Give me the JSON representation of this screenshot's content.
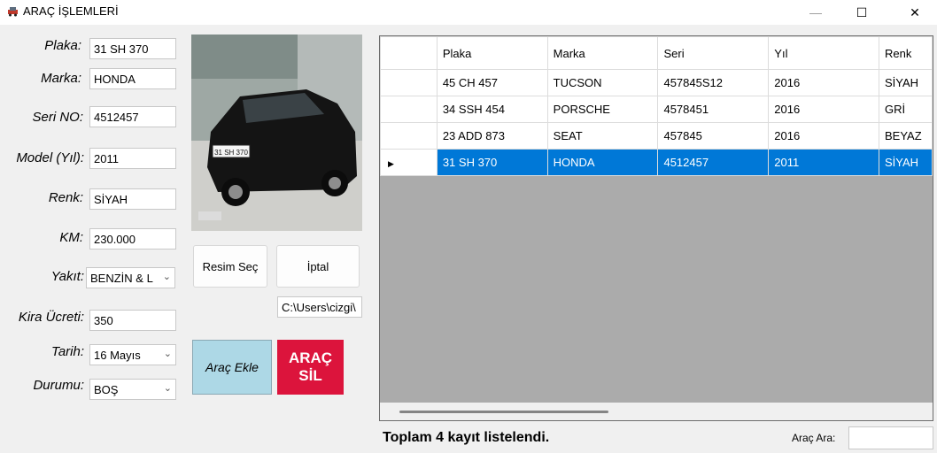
{
  "window": {
    "title": "ARAÇ İŞLEMLERİ",
    "minimize_glyph": "—",
    "maximize_glyph": "☐",
    "close_glyph": "✕"
  },
  "form": {
    "plaka_label": "Plaka:",
    "plaka_value": "31 SH 370",
    "marka_label": "Marka:",
    "marka_value": "HONDA",
    "seri_label": "Seri NO:",
    "seri_value": "4512457",
    "model_label": "Model (Yıl):",
    "model_value": "2011",
    "renk_label": "Renk:",
    "renk_value": "SİYAH",
    "km_label": "KM:",
    "km_value": "230.000",
    "yakit_label": "Yakıt:",
    "yakit_value": "BENZİN & L",
    "kira_label": "Kira Ücreti:",
    "kira_value": "350",
    "tarih_label": "Tarih:",
    "tarih_value": "16  Mayıs",
    "durum_label": "Durumu:",
    "durum_value": "BOŞ"
  },
  "image_panel": {
    "plate_text": "31 SH 370",
    "select_button": "Resim Seç",
    "cancel_button": "İptal",
    "path_value": "C:\\Users\\cizgi\\"
  },
  "actions": {
    "add_label": "Araç Ekle",
    "delete_label": "ARAÇ SİL"
  },
  "grid": {
    "columns": [
      "Plaka",
      "Marka",
      "Seri",
      "Yıl",
      "Renk"
    ],
    "rows": [
      [
        "45 CH 457",
        "TUCSON",
        "457845S12",
        "2016",
        "SİYAH"
      ],
      [
        "34 SSH 454",
        "PORSCHE",
        "4578451",
        "2016",
        "GRİ"
      ],
      [
        "23 ADD 873",
        "SEAT",
        "457845",
        "2016",
        "BEYAZ"
      ],
      [
        "31 SH 370",
        "HONDA",
        "4512457",
        "2011",
        "SİYAH"
      ]
    ],
    "selected_row": 3,
    "selection_color": "#0078d7"
  },
  "footer": {
    "total_text": "Toplam 4 kayıt listelendi.",
    "search_label": "Araç Ara:",
    "search_value": ""
  },
  "colors": {
    "add_button": "#add8e6",
    "delete_button": "#dc143c"
  }
}
